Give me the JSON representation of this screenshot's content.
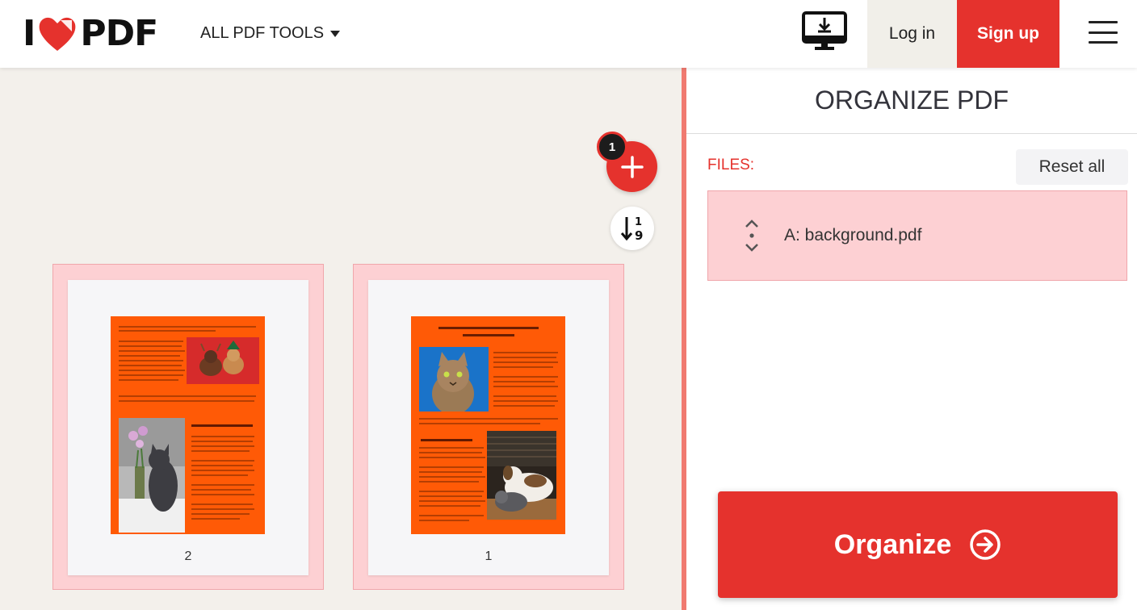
{
  "header": {
    "logo_left": "I",
    "logo_right": "PDF",
    "tools_menu_label": "ALL PDF TOOLS",
    "login_label": "Log in",
    "signup_label": "Sign up",
    "brand_color": "#e5322d"
  },
  "workspace": {
    "file_count": "1",
    "pages": [
      {
        "number": "2",
        "heading": "Animals Helping People"
      },
      {
        "number": "1",
        "heading": "The Health and Mood-boosting Benefits of Pets",
        "subheading": "Pets Give Health Effects"
      }
    ]
  },
  "sidebar": {
    "title": "ORGANIZE PDF",
    "files_label": "FILES:",
    "reset_label": "Reset all",
    "files": [
      {
        "name": "A: background.pdf"
      }
    ],
    "organize_label": "Organize"
  },
  "icons": [
    "heart-logo-icon",
    "caret-down-icon",
    "desktop-download-icon",
    "hamburger-menu-icon",
    "plus-icon",
    "sort-numeric-icon",
    "drag-handle-icon",
    "arrow-right-circle-icon"
  ]
}
